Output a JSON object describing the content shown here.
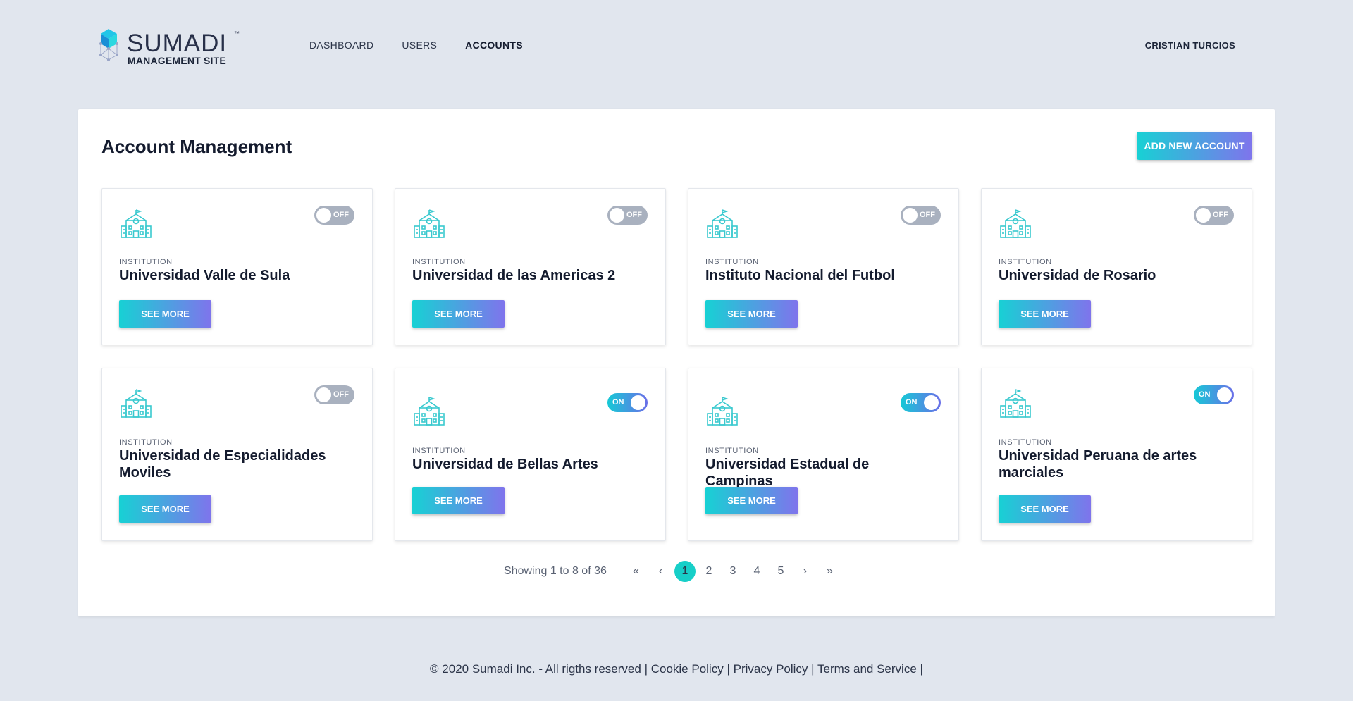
{
  "brand": {
    "name": "SUMADI",
    "trademark": "™",
    "subtitle": "MANAGEMENT SITE"
  },
  "nav": {
    "items": [
      {
        "label": "DASHBOARD",
        "active": false
      },
      {
        "label": "USERS",
        "active": false
      },
      {
        "label": "ACCOUNTS",
        "active": true
      }
    ],
    "user": "CRISTIAN TURCIOS"
  },
  "page": {
    "title": "Account Management",
    "add_button": "ADD NEW ACCOUNT"
  },
  "accounts": [
    {
      "label": "INSTITUTION",
      "name": "Universidad Valle de Sula",
      "status": "OFF",
      "button": "SEE MORE"
    },
    {
      "label": "INSTITUTION",
      "name": "Universidad de las Americas 2",
      "status": "OFF",
      "button": "SEE MORE"
    },
    {
      "label": "INSTITUTION",
      "name": "Instituto Nacional del Futbol",
      "status": "OFF",
      "button": "SEE MORE"
    },
    {
      "label": "INSTITUTION",
      "name": "Universidad de Rosario",
      "status": "OFF",
      "button": "SEE MORE"
    },
    {
      "label": "INSTITUTION",
      "name": "Universidad de Especialidades Moviles",
      "status": "OFF",
      "button": "SEE MORE"
    },
    {
      "label": "INSTITUTION",
      "name": "Universidad de Bellas Artes",
      "status": "ON",
      "button": "SEE MORE"
    },
    {
      "label": "INSTITUTION",
      "name": "Universidad Estadual de Campinas",
      "status": "ON",
      "button": "SEE MORE"
    },
    {
      "label": "INSTITUTION",
      "name": "Universidad Peruana de artes marciales",
      "status": "ON",
      "button": "SEE MORE"
    }
  ],
  "pagination": {
    "showing": "Showing 1 to 8 of 36",
    "first": "«",
    "prev": "‹",
    "pages": [
      "1",
      "2",
      "3",
      "4",
      "5"
    ],
    "current": "1",
    "next": "›",
    "last": "»"
  },
  "footer": {
    "copyright": "© 2020 Sumadi Inc. - All rigths reserved",
    "sep": "|",
    "links": [
      "Cookie Policy",
      "Privacy Policy",
      "Terms and Service"
    ]
  },
  "colors": {
    "accent_start": "#17d1d4",
    "accent_end": "#7f74ec",
    "background": "#e1e6ee",
    "toggle_off": "#a9b1bf",
    "icon": "#39c9cf"
  },
  "icons": {
    "logo": "hexagon-cube-logo",
    "institution": "school-building-icon"
  }
}
